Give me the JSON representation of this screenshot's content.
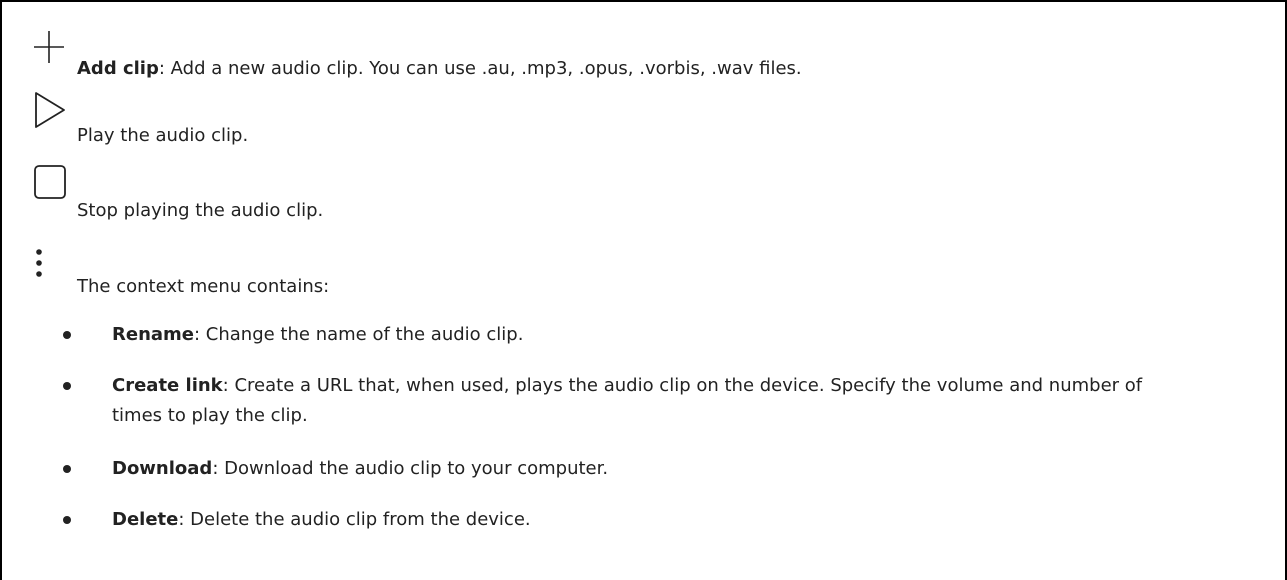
{
  "entries": [
    {
      "icon": "plus-icon",
      "term": "Add clip",
      "sep": ": ",
      "text": "Add a new audio clip. You can use .au, .mp3, .opus, .vorbis, .wav files."
    },
    {
      "icon": "play-icon",
      "text": "Play the audio clip."
    },
    {
      "icon": "stop-icon",
      "text": "Stop playing the audio clip."
    },
    {
      "icon": "more-vertical-icon",
      "text": "The context menu contains:"
    }
  ],
  "menu_items": [
    {
      "term": "Rename",
      "sep": ": ",
      "text": "Change the name of the audio clip."
    },
    {
      "term": "Create link",
      "sep": ": ",
      "text": "Create a URL that, when used, plays the audio clip on the device. Specify the volume and number of times to play the clip."
    },
    {
      "term": "Download",
      "sep": ": ",
      "text": "Download the audio clip to your computer."
    },
    {
      "term": "Delete",
      "sep": ": ",
      "text": "Delete the audio clip from the device."
    }
  ]
}
